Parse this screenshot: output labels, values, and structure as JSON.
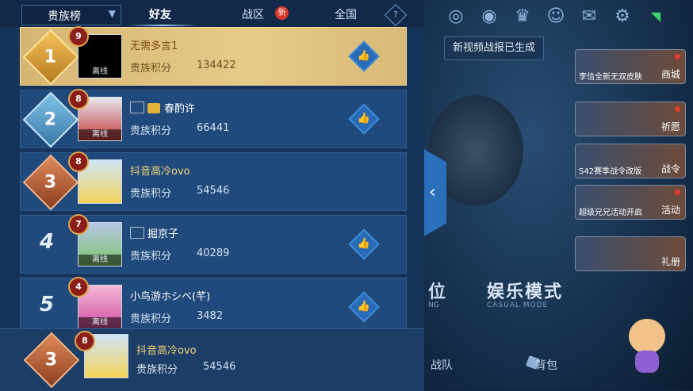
{
  "tabs": {
    "dropdown_label": "贵族榜",
    "friends": "好友",
    "region": "战区",
    "new_badge": "新",
    "national": "全国",
    "help": "?"
  },
  "rows": [
    {
      "rank": "1",
      "level": "9",
      "name": "无需多言1",
      "score_label": "贵族积分",
      "score": "134422",
      "status": "离线"
    },
    {
      "rank": "2",
      "level": "8",
      "name": "春酌许",
      "score_label": "贵族积分",
      "score": "66441",
      "status": "离线"
    },
    {
      "rank": "3",
      "level": "8",
      "name": "抖音高冷ovo",
      "score_label": "贵族积分",
      "score": "54546",
      "status": ""
    },
    {
      "rank": "4",
      "level": "7",
      "name": "掘京子",
      "score_label": "贵族积分",
      "score": "40289",
      "status": "离线"
    },
    {
      "rank": "5",
      "level": "4",
      "name": "小鸟游ホシベ(芊)",
      "score_label": "贵族积分",
      "score": "3482",
      "status": "离线"
    }
  ],
  "self_row": {
    "rank": "3",
    "level": "8",
    "name": "抖音高冷ovo",
    "score_label": "贵族积分",
    "score": "54546"
  },
  "background": {
    "tooltip": "新视频战报已生成",
    "side_buttons": [
      {
        "label": "商城",
        "sub": "李信全新无双皮肤"
      },
      {
        "label": "祈愿",
        "sub": ""
      },
      {
        "label": "战令",
        "sub": "S42赛季战令改版"
      },
      {
        "label": "活动",
        "sub": "超级兄兄活动开启"
      },
      {
        "label": "礼册",
        "sub": ""
      }
    ],
    "mode_left": "位",
    "mode_left_sub": "NG",
    "mode_title": "娱乐模式",
    "mode_sub": "CASUAL MODE",
    "nav_battle": "战队",
    "nav_bag": "背包"
  },
  "colors": {
    "accent": "#2a6bb7",
    "gold": "#e6ca88",
    "new_badge": "#d9352b"
  }
}
